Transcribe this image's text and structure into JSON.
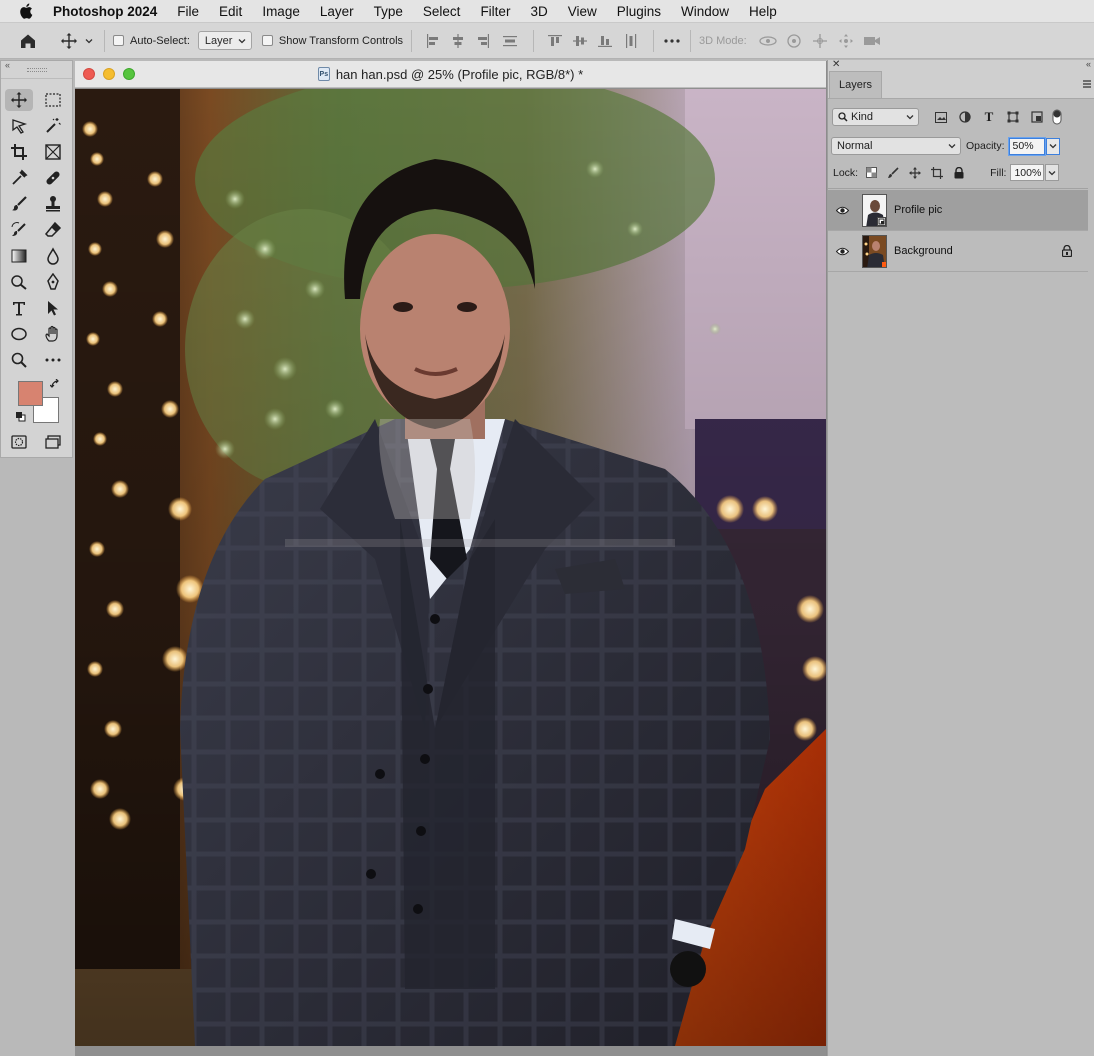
{
  "menubar": {
    "app_name": "Photoshop 2024",
    "items": [
      "File",
      "Edit",
      "Image",
      "Layer",
      "Type",
      "Select",
      "Filter",
      "3D",
      "View",
      "Plugins",
      "Window",
      "Help"
    ]
  },
  "options_bar": {
    "auto_select_label": "Auto-Select:",
    "auto_select_checked": false,
    "auto_select_target": "Layer",
    "show_transform_label": "Show Transform Controls",
    "show_transform_checked": false,
    "mode_3d_label": "3D Mode:"
  },
  "tools": {
    "foreground_color": "#d78370",
    "background_color": "#ffffff",
    "active_tool": "move-tool"
  },
  "document": {
    "filename": "han han.psd",
    "title": "han han.psd @ 25% (Profile pic, RGB/8*) *",
    "file_icon": "Ps"
  },
  "layers_panel": {
    "tab_label": "Layers",
    "filter_kind": "Kind",
    "blend_mode": "Normal",
    "opacity_label": "Opacity:",
    "opacity_value": "50%",
    "lock_label": "Lock:",
    "fill_label": "Fill:",
    "fill_value": "100%",
    "layers": [
      {
        "name": "Profile pic",
        "visible": true,
        "selected": true,
        "locked": false,
        "smart_object": true
      },
      {
        "name": "Background",
        "visible": true,
        "selected": false,
        "locked": true,
        "smart_object": false
      }
    ]
  }
}
